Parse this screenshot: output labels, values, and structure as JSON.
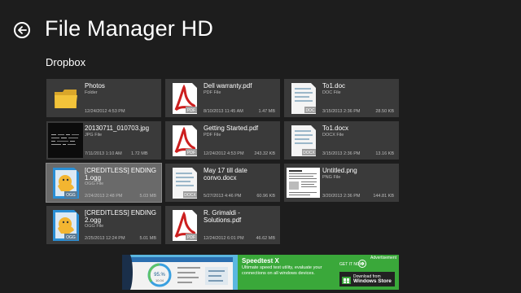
{
  "header": {
    "title": "File Manager HD"
  },
  "section": {
    "title": "Dropbox"
  },
  "files": [
    {
      "name": "Photos",
      "type": "Folder",
      "date": "12/24/2012 4:53 PM",
      "size": "",
      "icon": "folder-icon",
      "badge": ""
    },
    {
      "name": "Dell warranty.pdf",
      "type": "PDF File",
      "date": "8/10/2013 11:45 AM",
      "size": "1.47 MB",
      "icon": "pdf-icon",
      "badge": "PDF"
    },
    {
      "name": "To1.doc",
      "type": "DOC File",
      "date": "3/15/2013 2:36 PM",
      "size": "28.50 KB",
      "icon": "doc-icon",
      "badge": "DOC"
    },
    {
      "name": "20130711_010703.jpg",
      "type": "JPG File",
      "date": "7/11/2013 1:10 AM",
      "size": "1.72 MB",
      "icon": "image-thumbnail",
      "badge": ""
    },
    {
      "name": "Getting Started.pdf",
      "type": "PDF File",
      "date": "12/24/2012 4:53 PM",
      "size": "243.32 KB",
      "icon": "pdf-icon",
      "badge": "PDF"
    },
    {
      "name": "To1.docx",
      "type": "DOCX File",
      "date": "3/15/2013 2:36 PM",
      "size": "13.16 KB",
      "icon": "docx-icon",
      "badge": "DOCX"
    },
    {
      "name": "[CREDITLESS] ENDING 1.ogg",
      "type": "OGG File",
      "date": "2/24/2013 2:48 PM",
      "size": "5.03 MB",
      "icon": "ogg-icon",
      "badge": "OGG"
    },
    {
      "name": "May 17 till date convo.docx",
      "type": "",
      "date": "5/27/2013 4:46 PM",
      "size": "60.96 KB",
      "icon": "docx-icon",
      "badge": "DOCX"
    },
    {
      "name": "Untitled.png",
      "type": "PNG File",
      "date": "3/20/2013 2:36 PM",
      "size": "144.81 KB",
      "icon": "png-thumbnail",
      "badge": ""
    },
    {
      "name": "[CREDITLESS] ENDING 2.ogg",
      "type": "OGG File",
      "date": "2/25/2013 12:24 PM",
      "size": "5.01 MB",
      "icon": "ogg-icon",
      "badge": "OGG"
    },
    {
      "name": "R. Grimaldi - Solutions.pdf",
      "type": "",
      "date": "12/24/2012 6:01 PM",
      "size": "46.62 MB",
      "icon": "pdf-icon",
      "badge": "PDF"
    }
  ],
  "ad": {
    "label": "Advertisement",
    "title": "Speedtest X",
    "description": "Ultimate speed test utility, evaluate your connections on all windows devices.",
    "get_it_now": "GET IT NOW",
    "store_line1": "Download from",
    "store_line2": "Windows Store",
    "gauge_value": "95.%",
    "gauge_sub": "10.04"
  },
  "colors": {
    "background": "#1d1d1d",
    "tile": "#3a3a3a",
    "tile_selected": "#6a6a6a",
    "pdf_red": "#cc1f1f",
    "folder_yellow": "#f2c33a",
    "ad_green": "#3aa83a",
    "ogg_blue": "#2a8fd6"
  }
}
